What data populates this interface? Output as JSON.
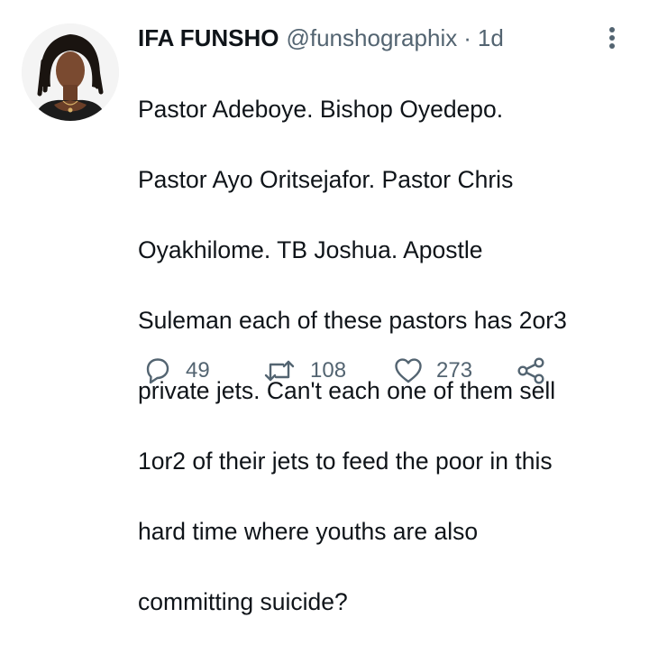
{
  "tweet": {
    "author": {
      "name": "IFA FUNSHO",
      "handle": "@funshographix",
      "separator": "·",
      "time": "1d"
    },
    "text_lines": [
      "Pastor Adeboye. Bishop Oyedepo.",
      "Pastor Ayo Oritsejafor. Pastor Chris",
      "Oyakhilome. TB Joshua. Apostle",
      "Suleman each of these pastors has 2or3",
      "private jets. Can't each one of them sell",
      "1or2 of their jets to feed the poor in this",
      "hard time where youths are also",
      "committing suicide?"
    ],
    "actions": {
      "reply_count": "49",
      "retweet_count": "108",
      "like_count": "273"
    },
    "icons": {
      "reply": "reply-icon",
      "retweet": "retweet-icon",
      "like": "heart-icon",
      "share": "share-icon",
      "more": "more-vertical-icon"
    },
    "colors": {
      "text": "#0f1419",
      "secondary": "#536471",
      "background": "#ffffff"
    }
  }
}
